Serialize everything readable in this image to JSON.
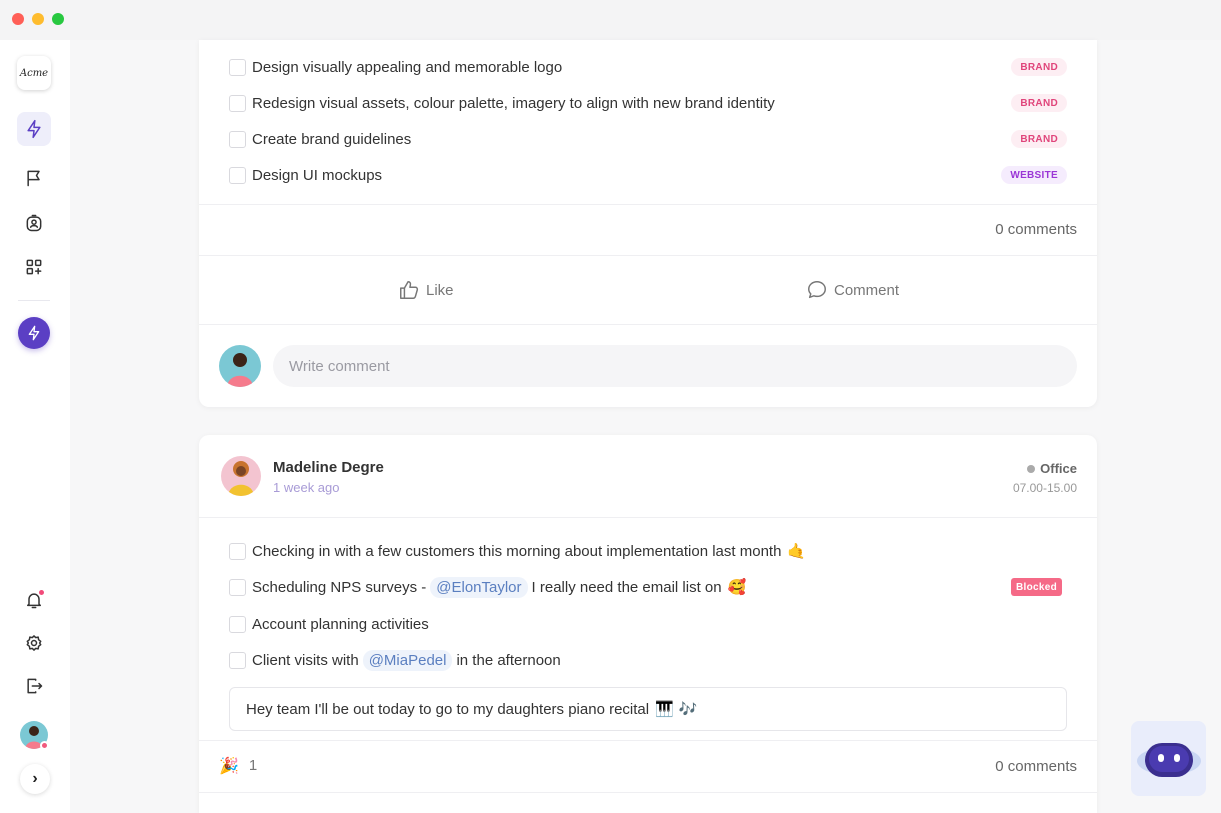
{
  "app": {
    "logo_text": "Acme"
  },
  "sidebar": {
    "items": [
      {
        "name": "activity",
        "icon": "bolt-icon"
      },
      {
        "name": "goals",
        "icon": "flag-icon"
      },
      {
        "name": "people",
        "icon": "user-badge-icon"
      },
      {
        "name": "apps",
        "icon": "apps-add-icon"
      }
    ],
    "bottom": [
      "bell-icon",
      "gear-icon",
      "logout-icon"
    ],
    "expand_label": "›"
  },
  "post1": {
    "tasks": [
      {
        "text": "Design visually appealing and memorable logo",
        "tag": "BRAND"
      },
      {
        "text": "Redesign visual assets, colour palette, imagery to align with new brand identity",
        "tag": "BRAND"
      },
      {
        "text": "Create brand guidelines",
        "tag": "BRAND"
      },
      {
        "text": "Design UI mockups",
        "tag": "WEBSITE"
      }
    ],
    "comments_count": "0 comments",
    "like_label": "Like",
    "comment_label": "Comment",
    "comment_placeholder": "Write comment"
  },
  "post2": {
    "author": "Madeline Degre",
    "time": "1 week ago",
    "location": "Office",
    "hours": "07.00-15.00",
    "task1": {
      "text": "Checking in with a few customers this morning about implementation last month",
      "emoji": "🤙"
    },
    "task2": {
      "before": "Scheduling NPS surveys -",
      "mention": "@ElonTaylor",
      "after": "I really need the email list on",
      "emoji": "🥰",
      "tag": "Blocked"
    },
    "task3": {
      "text": "Account planning activities"
    },
    "task4": {
      "before": "Client visits with",
      "mention": "@MiaPedel",
      "after": "in the afternoon"
    },
    "note": {
      "text": "Hey team I'll be out today to go to my daughters piano recital",
      "emoji": "🎹 🎶"
    },
    "reaction": {
      "emoji": "🎉",
      "count": "1"
    },
    "comments_count": "0 comments"
  },
  "colors": {
    "accent": "#5b3fc4",
    "brand_tag": "#e0457b",
    "website_tag": "#9b36d6",
    "blocked_tag": "#f56a87"
  }
}
